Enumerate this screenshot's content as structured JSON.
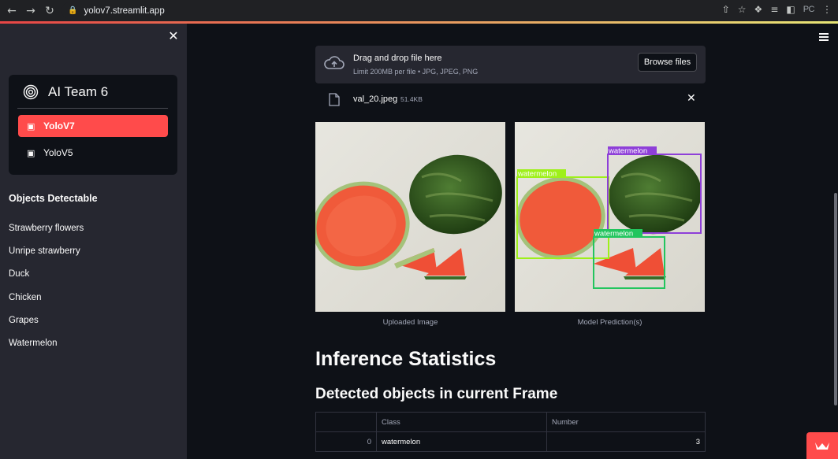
{
  "browser": {
    "url": "yolov7.streamlit.app",
    "profile": "PC"
  },
  "sidebar": {
    "menu_title": "AI Team 6",
    "menu_items": [
      {
        "label": "YoloV7",
        "active": true
      },
      {
        "label": "YoloV5",
        "active": false
      }
    ],
    "objects_title": "Objects Detectable",
    "objects": [
      "Strawberry flowers",
      "Unripe strawberry",
      "Duck",
      "Chicken",
      "Grapes",
      "Watermelon"
    ]
  },
  "uploader": {
    "title": "Drag and drop file here",
    "subtitle": "Limit 200MB per file • JPG, JPEG, PNG",
    "button": "Browse files"
  },
  "file": {
    "name": "val_20.jpeg",
    "size": "51.4KB"
  },
  "images": {
    "uploaded_caption": "Uploaded Image",
    "prediction_caption": "Model Prediction(s)",
    "detections": [
      {
        "label": "watermelon",
        "color": "#9ef01a"
      },
      {
        "label": "watermelon",
        "color": "#8e3fd8"
      },
      {
        "label": "watermelon",
        "color": "#22c55e"
      }
    ]
  },
  "stats": {
    "heading": "Inference Statistics",
    "subheading": "Detected objects in current Frame",
    "columns": [
      "",
      "Class",
      "Number"
    ],
    "rows": [
      {
        "index": "0",
        "class": "watermelon",
        "number": "3"
      }
    ]
  },
  "colors": {
    "accent": "#ff4b4b",
    "background": "#0e1117",
    "sidebar": "#262730"
  }
}
